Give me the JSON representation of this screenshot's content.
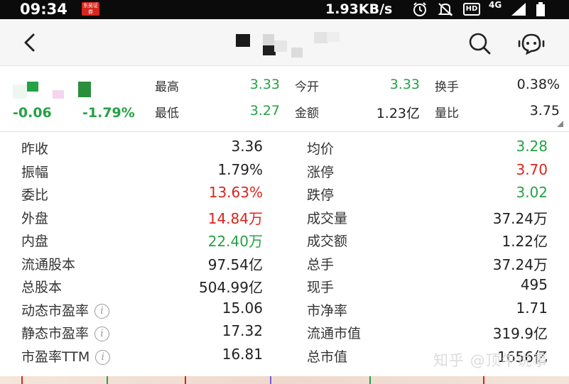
{
  "status_bar": {
    "time": "09:34",
    "app_badge": "东吴证券",
    "network_speed": "1.93KB/s",
    "icons": [
      "alarm-icon",
      "mute-icon",
      "hd-icon",
      "4g-icon",
      "signal-icon",
      "battery-icon"
    ],
    "network_type": "4G",
    "hd_label": "HD"
  },
  "header": {
    "back_icon": "chevron-left-icon",
    "search_icon": "search-icon",
    "service_icon": "chat-bot-icon"
  },
  "summary": {
    "change": "-0.06",
    "change_percent": "-1.79%",
    "items": [
      {
        "label": "最高",
        "value": "3.33",
        "color": "green"
      },
      {
        "label": "今开",
        "value": "3.33",
        "color": "green"
      },
      {
        "label": "换手",
        "value": "0.38%",
        "color": "normal"
      },
      {
        "label": "最低",
        "value": "3.27",
        "color": "green"
      },
      {
        "label": "金额",
        "value": "1.23亿",
        "color": "normal"
      },
      {
        "label": "量比",
        "value": "3.75",
        "color": "normal"
      }
    ]
  },
  "details": [
    {
      "left_label": "昨收",
      "left_value": "3.36",
      "left_color": "normal",
      "right_label": "均价",
      "right_value": "3.28",
      "right_color": "green",
      "info": false
    },
    {
      "left_label": "振幅",
      "left_value": "1.79%",
      "left_color": "normal",
      "right_label": "涨停",
      "right_value": "3.70",
      "right_color": "red",
      "info": false
    },
    {
      "left_label": "委比",
      "left_value": "13.63%",
      "left_color": "red",
      "right_label": "跌停",
      "right_value": "3.02",
      "right_color": "green",
      "info": false
    },
    {
      "left_label": "外盘",
      "left_value": "14.84万",
      "left_color": "red",
      "right_label": "成交量",
      "right_value": "37.24万",
      "right_color": "normal",
      "info": false
    },
    {
      "left_label": "内盘",
      "left_value": "22.40万",
      "left_color": "green",
      "right_label": "成交额",
      "right_value": "1.22亿",
      "right_color": "normal",
      "info": false
    },
    {
      "left_label": "流通股本",
      "left_value": "97.54亿",
      "left_color": "normal",
      "right_label": "总手",
      "right_value": "37.24万",
      "right_color": "normal",
      "info": false
    },
    {
      "left_label": "总股本",
      "left_value": "504.99亿",
      "left_color": "normal",
      "right_label": "现手",
      "right_value": "495",
      "right_color": "normal",
      "info": false
    },
    {
      "left_label": "动态市盈率",
      "left_value": "15.06",
      "left_color": "normal",
      "right_label": "市净率",
      "right_value": "1.71",
      "right_color": "normal",
      "info": true
    },
    {
      "left_label": "静态市盈率",
      "left_value": "17.32",
      "left_color": "normal",
      "right_label": "流通市值",
      "right_value": "319.9亿",
      "right_color": "normal",
      "info": true
    },
    {
      "left_label": "市盈率TTM",
      "left_value": "16.81",
      "left_color": "normal",
      "right_label": "总市值",
      "right_value": "1656亿",
      "right_color": "normal",
      "info": true
    }
  ],
  "info_glyph": "i",
  "watermark": "知乎 @顶牛说事",
  "colors": {
    "up": "#d8261b",
    "down": "#25a244",
    "status_bar": "#0b0b0b",
    "header_bg": "#f6f6f6"
  }
}
